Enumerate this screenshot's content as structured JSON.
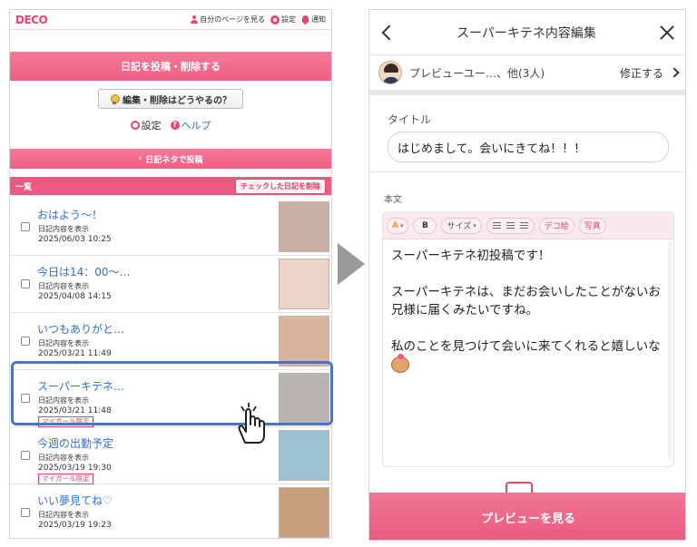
{
  "phone_left": {
    "logo": "DECO",
    "nav": {
      "my_page": "自分のページを見る",
      "settings": "設定",
      "notifications": "通知"
    },
    "post_banner": "日記を投稿・削除する",
    "howto_button": "編集・削除はどうやるの？",
    "links": {
      "settings": "設定",
      "help": "ヘルプ"
    },
    "neta_banner": "日記ネタで投稿",
    "list_title": "一覧",
    "delete_checked_button": "チェックした日記を削除",
    "diary_list": {
      "entries": [
        {
          "title": "おはよう〜！",
          "sub": "日記内容を表示",
          "date": "2025/06/03 10:25",
          "badge": ""
        },
        {
          "title": "今日は14：00〜…",
          "sub": "日記内容を表示",
          "date": "2025/04/08 14:15",
          "badge": ""
        },
        {
          "title": "いつもありがと…",
          "sub": "日記内容を表示",
          "date": "2025/03/21 11:49",
          "badge": ""
        },
        {
          "title": "スーパーキテネ…",
          "sub": "日記内容を表示",
          "date": "2025/03/21 11:48",
          "badge": "マイガール限定"
        },
        {
          "title": "今週の出勤予定",
          "sub": "日記内容を表示",
          "date": "2025/03/19 19:30",
          "badge": "マイガール限定"
        },
        {
          "title": "いい夢見てね♡",
          "sub": "日記内容を表示",
          "date": "2025/03/19 19:23",
          "badge": ""
        }
      ]
    }
  },
  "phone_right": {
    "header_title": "スーパーキテネ内容編集",
    "preview_audience": "プレビューユー…、他(3人)",
    "edit_link": "修正する",
    "title_label": "タイトル",
    "title_value": "はじめまして。会いにきてね！！！",
    "body_label": "本文",
    "toolbar": {
      "color": "A",
      "bold": "B",
      "size": "サイズ",
      "deco": "デコ絵",
      "photo": "写真"
    },
    "body_text": "スーパーキテネ初投稿です！\n\nスーパーキテネは、まだお会いしたことがないお兄様に届くみたいですね。\n\n私のことを見つけて会いに来てくれると嬉しいな",
    "preview_button": "プレビューを見る"
  },
  "colors": {
    "brand_pink": "#e8456d",
    "banner_pink": "#f57a98",
    "link_blue": "#2f6fd3",
    "highlight_blue": "#4a74c9"
  }
}
